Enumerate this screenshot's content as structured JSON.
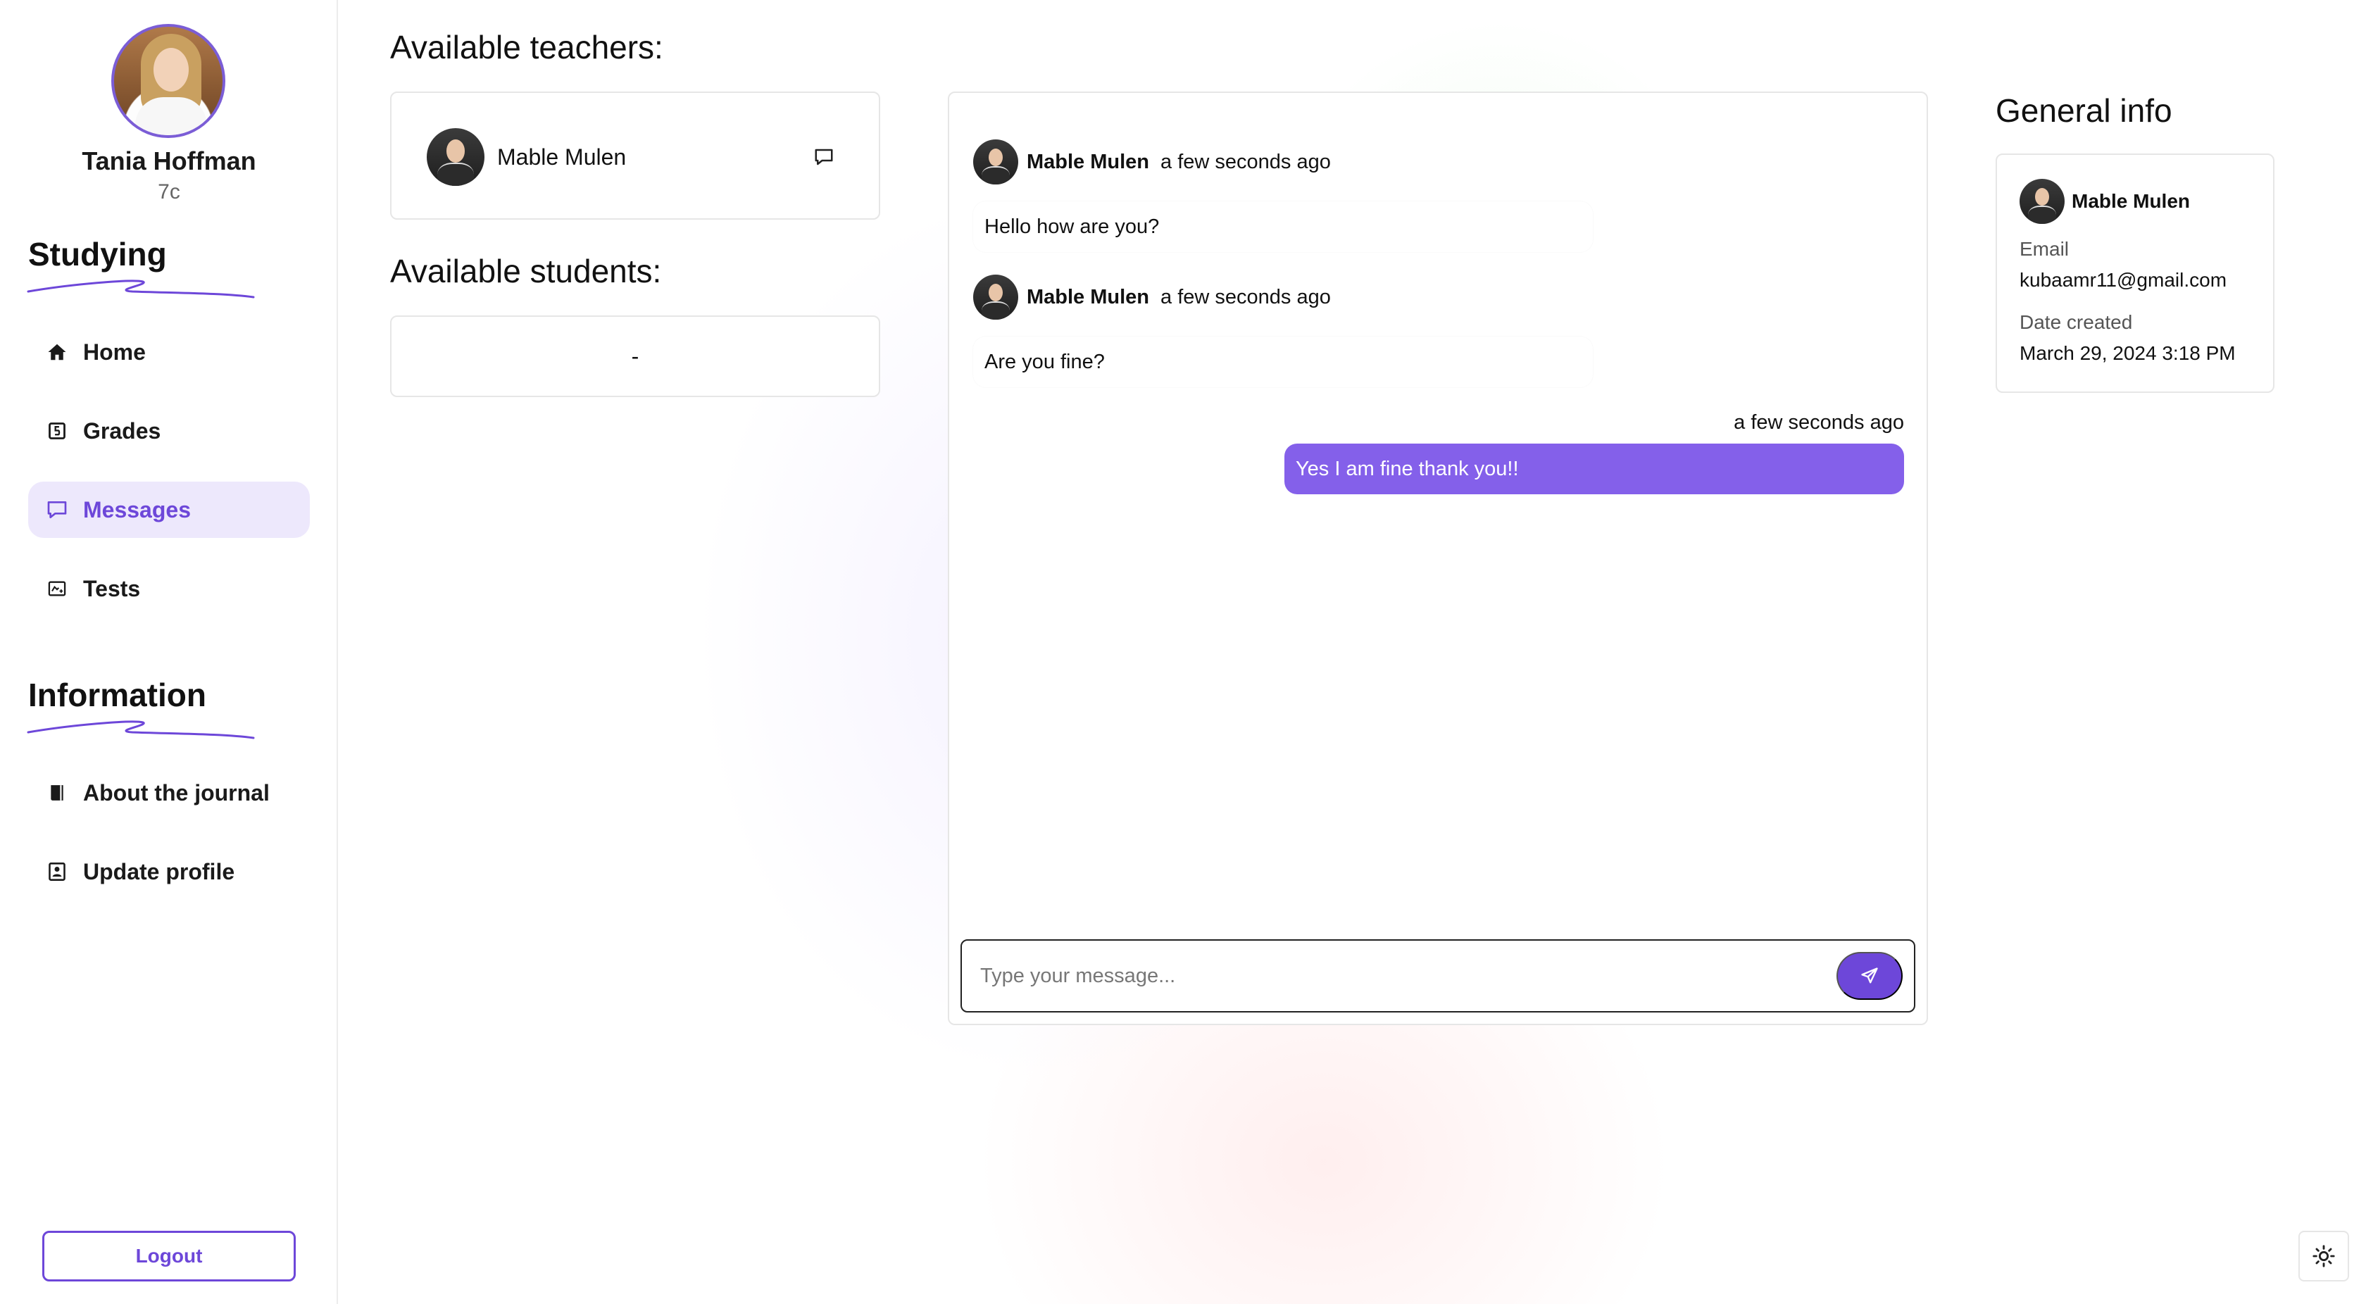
{
  "user": {
    "name": "Tania Hoffman",
    "class": "7c"
  },
  "sidebar": {
    "studying_title": "Studying",
    "studying_items": [
      {
        "label": "Home",
        "icon": "home-icon"
      },
      {
        "label": "Grades",
        "icon": "grades-icon"
      },
      {
        "label": "Messages",
        "icon": "message-icon",
        "active": true
      },
      {
        "label": "Tests",
        "icon": "tests-icon"
      }
    ],
    "information_title": "Information",
    "information_items": [
      {
        "label": "About the journal",
        "icon": "book-icon"
      },
      {
        "label": "Update profile",
        "icon": "profile-icon"
      }
    ],
    "logout_label": "Logout"
  },
  "teachers": {
    "title": "Available teachers:",
    "items": [
      {
        "name": "Mable Mulen"
      }
    ]
  },
  "students": {
    "title": "Available students:",
    "empty_text": "-"
  },
  "chat": {
    "messages": [
      {
        "sender": "Mable Mulen",
        "time": "a few seconds ago",
        "text": "Hello how are you?"
      },
      {
        "sender": "Mable Mulen",
        "time": "a few seconds ago",
        "text": "Are you fine?"
      },
      {
        "sender": "me",
        "time": "a few seconds ago",
        "text": "Yes I am fine thank you!!"
      }
    ],
    "composer_placeholder": "Type your message..."
  },
  "general_info": {
    "title": "General info",
    "name": "Mable Mulen",
    "email_label": "Email",
    "email": "kubaamr11@gmail.com",
    "date_label": "Date created",
    "date": "March 29, 2024 3:18 PM"
  },
  "colors": {
    "accent": "#6d47d9",
    "outgoing_bubble": "#8460ea",
    "active_nav_bg": "#ede8fc"
  }
}
